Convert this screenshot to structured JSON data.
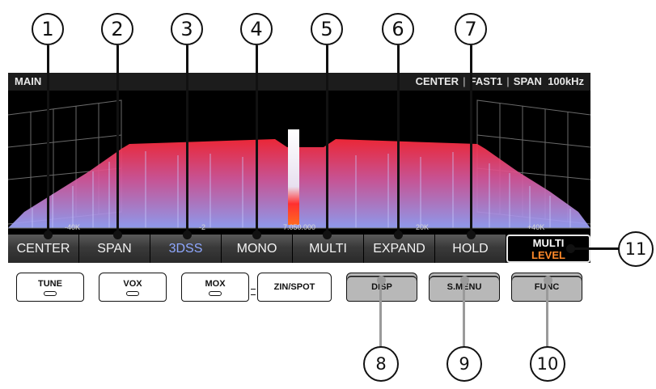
{
  "callouts_top": [
    "1",
    "2",
    "3",
    "4",
    "5",
    "6",
    "7"
  ],
  "callout_right": "11",
  "callouts_bottom": [
    "8",
    "9",
    "10"
  ],
  "screen": {
    "title_left": "MAIN",
    "title_right": [
      "CENTER",
      "FAST1",
      "SPAN",
      "100kHz"
    ],
    "freq_ticks": [
      "-40K",
      "-2",
      "7.050.000",
      "20K",
      "+40K"
    ],
    "softkeys": [
      "CENTER",
      "SPAN",
      "3DSS",
      "MONO",
      "MULTI",
      "EXPAND",
      "HOLD"
    ],
    "softkey_right": {
      "line1": "MULTI",
      "line2": "LEVEL"
    },
    "colors": {
      "peak": "#ff2a3c",
      "floor": "#9aa6ff",
      "accent_3dss": "#8fa8ff",
      "level_orange": "#ff8a2a"
    }
  },
  "hardware_keys": [
    "TUNE",
    "VOX",
    "MOX",
    "ZIN/SPOT",
    "DISP",
    "S.MENU",
    "FUNC"
  ]
}
